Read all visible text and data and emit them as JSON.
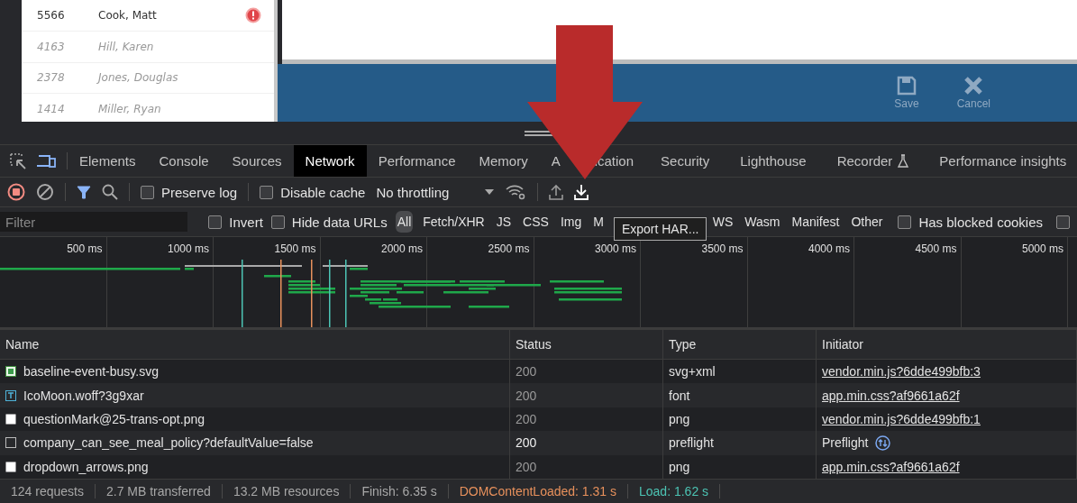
{
  "app": {
    "employees": [
      {
        "id": "5566",
        "name": "Cook, Matt",
        "inactive": false,
        "alert": true
      },
      {
        "id": "4163",
        "name": "Hill, Karen",
        "inactive": true,
        "alert": false
      },
      {
        "id": "2378",
        "name": "Jones, Douglas",
        "inactive": true,
        "alert": false
      },
      {
        "id": "1414",
        "name": "Miller, Ryan",
        "inactive": true,
        "alert": false
      }
    ],
    "actions": [
      {
        "kind": "save",
        "label": "Save",
        "disabled": true
      },
      {
        "kind": "cancel",
        "label": "Cancel",
        "disabled": true
      }
    ]
  },
  "devtools": {
    "tabs": [
      {
        "label": "Elements",
        "selected": false
      },
      {
        "label": "Console",
        "selected": false
      },
      {
        "label": "Sources",
        "selected": false
      },
      {
        "label": "Network",
        "selected": true
      },
      {
        "label": "Performance",
        "selected": false
      },
      {
        "label": "Memory",
        "selected": false
      },
      {
        "label_parts": [
          "A",
          "ication"
        ],
        "selected": false
      },
      {
        "label": "Security",
        "selected": false
      },
      {
        "label": "Lighthouse",
        "selected": false
      },
      {
        "label": "Recorder",
        "selected": false,
        "experimental": true
      },
      {
        "label": "Performance insights",
        "selected": false
      }
    ],
    "toolbar": {
      "recording": true,
      "filter_active": true,
      "preserve_log": {
        "label": "Preserve log",
        "checked": false
      },
      "disable_cache": {
        "label": "Disable cache",
        "checked": false
      },
      "throttling": "No throttling"
    },
    "filter_bar": {
      "placeholder": "Filter",
      "checkboxes_left": [
        {
          "label": "Invert",
          "checked": false
        },
        {
          "label": "Hide data URLs",
          "checked": false
        }
      ],
      "types_before": [
        {
          "label": "All",
          "selected": true
        },
        {
          "label": "Fetch/XHR",
          "selected": false
        },
        {
          "label": "JS",
          "selected": false
        },
        {
          "label": "CSS",
          "selected": false
        },
        {
          "label": "Img",
          "selected": false
        },
        {
          "label": "M",
          "selected": false
        }
      ],
      "tooltip": "Export HAR...",
      "types_after": [
        {
          "label": "WS",
          "selected": false
        },
        {
          "label": "Wasm",
          "selected": false
        },
        {
          "label": "Manifest",
          "selected": false
        },
        {
          "label": "Other",
          "selected": false
        }
      ],
      "checkboxes_right": [
        {
          "label": "Has blocked cookies",
          "checked": false
        },
        {
          "checked": false
        }
      ]
    },
    "timeline": {
      "ticks": [
        "500 ms",
        "1000 ms",
        "1500 ms",
        "2000 ms",
        "2500 ms",
        "3000 ms",
        "3500 ms",
        "4000 ms",
        "4500 ms",
        "5000 ms"
      ]
    },
    "table": {
      "columns": [
        "Name",
        "Status",
        "Type",
        "Initiator"
      ],
      "rows": [
        {
          "kind": "svg",
          "name": "baseline-event-busy.svg",
          "status": "200",
          "type": "svg+xml",
          "initiator": "vendor.min.js?6dde499bfb:3"
        },
        {
          "kind": "font",
          "name": "IcoMoon.woff?3g9xar",
          "status": "200",
          "type": "font",
          "initiator": "app.min.css?af9661a62f"
        },
        {
          "kind": "png",
          "name": "questionMark@25-trans-opt.png",
          "status": "200",
          "type": "png",
          "initiator": "vendor.min.js?6dde499bfb:1"
        },
        {
          "kind": "preflight",
          "name": "company_can_see_meal_policy?defaultValue=false",
          "status": "200",
          "type": "preflight",
          "initiator": "Preflight"
        },
        {
          "kind": "png",
          "name": "dropdown_arrows.png",
          "status": "200",
          "type": "png",
          "initiator": "app.min.css?af9661a62f"
        }
      ]
    },
    "status_bar": [
      {
        "text": "124 requests",
        "color": "#a8a8a8"
      },
      {
        "text": "2.7 MB transferred",
        "color": "#a8a8a8"
      },
      {
        "text": "13.2 MB resources",
        "color": "#a8a8a8"
      },
      {
        "text": "Finish: 6.35 s",
        "color": "#a8a8a8"
      },
      {
        "text": "DOMContentLoaded: 1.31 s",
        "color": "#e8915c"
      },
      {
        "text": "Load: 1.62 s",
        "color": "#4cc4b4"
      }
    ]
  }
}
